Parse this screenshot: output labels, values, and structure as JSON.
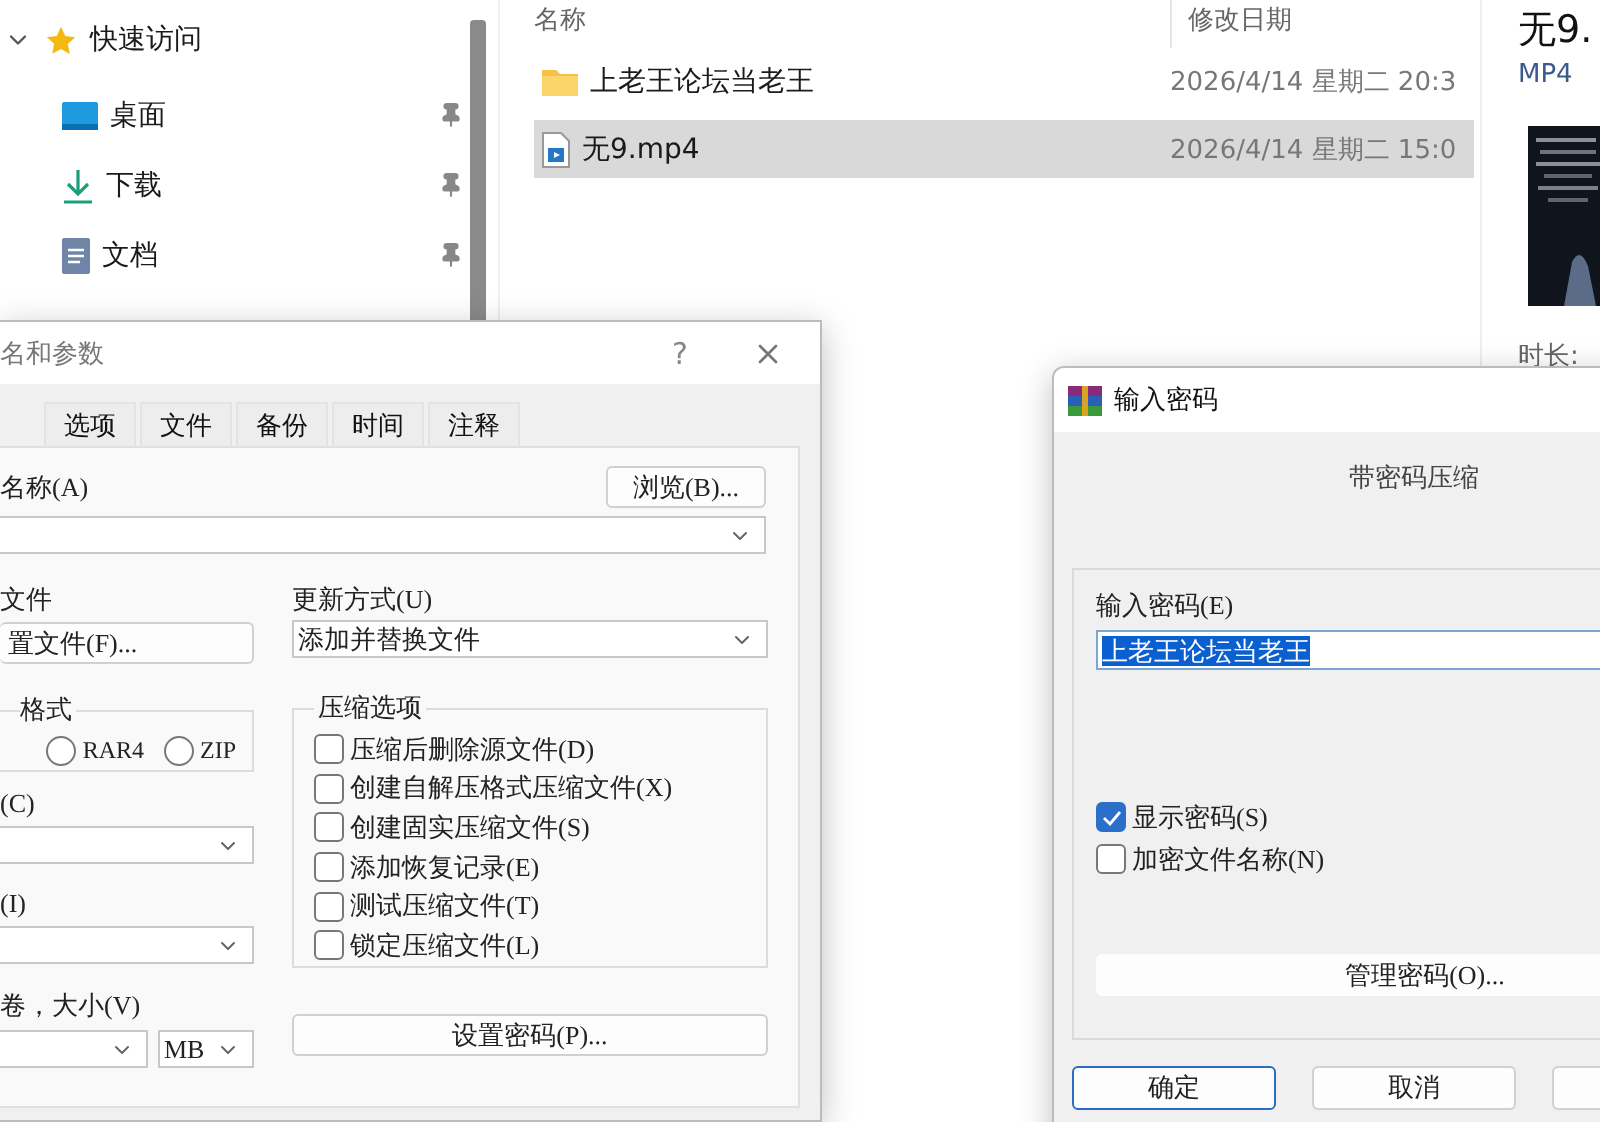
{
  "explorer": {
    "nav": {
      "header": {
        "label": "快速访问",
        "expanded": true
      },
      "items": [
        {
          "label": "桌面",
          "kind": "desktop",
          "pinned": true
        },
        {
          "label": "下载",
          "kind": "download",
          "pinned": true
        },
        {
          "label": "文档",
          "kind": "document",
          "pinned": true
        }
      ]
    },
    "columns": [
      "名称",
      "修改日期"
    ],
    "rows": [
      {
        "kind": "folder",
        "name": "上老王论坛当老王",
        "date": "2026/4/14 星期二 20:3",
        "selected": false
      },
      {
        "kind": "video",
        "name": "无9.mp4",
        "date": "2026/4/14 星期二 15:0",
        "selected": true
      }
    ],
    "preview": {
      "title": "无9.",
      "type": "MP4",
      "duration_label": "时长:"
    }
  },
  "archive_dialog": {
    "title": "名和参数",
    "help": "?",
    "tabs": [
      {
        "label": "选项",
        "selected": false
      },
      {
        "label": "文件",
        "selected": false
      },
      {
        "label": "备份",
        "selected": false
      },
      {
        "label": "时间",
        "selected": false
      },
      {
        "label": "注释",
        "selected": false
      }
    ],
    "name_label": "名称(A)",
    "browse_button": "浏览(B)...",
    "profiles_label": "文件",
    "profiles_button": "置文件(F)...",
    "update_label": "更新方式(U)",
    "update_value": "添加并替换文件",
    "format_label": "格式",
    "formats": [
      {
        "label": "RAR4",
        "selected": false
      },
      {
        "label": "ZIP",
        "selected": false
      }
    ],
    "method_label": "(C)",
    "dictionary_label": "(I)",
    "volume_label": "卷，大小(V)",
    "volume_unit": "MB",
    "options_label": "压缩选项",
    "options": [
      {
        "label": "压缩后删除源文件(D)",
        "checked": false
      },
      {
        "label": "创建自解压格式压缩文件(X)",
        "checked": false
      },
      {
        "label": "创建固实压缩文件(S)",
        "checked": false
      },
      {
        "label": "添加恢复记录(E)",
        "checked": false
      },
      {
        "label": "测试压缩文件(T)",
        "checked": false
      },
      {
        "label": "锁定压缩文件(L)",
        "checked": false
      }
    ],
    "password_button": "设置密码(P)..."
  },
  "password_dialog": {
    "title": "输入密码",
    "heading": "带密码压缩",
    "password_label": "输入密码(E)",
    "password_value": "上老王论坛当老王",
    "value_selected": true,
    "checks": [
      {
        "label": "显示密码(S)",
        "checked": true
      },
      {
        "label": "加密文件名称(N)",
        "checked": false
      }
    ],
    "manage_button": "管理密码(O)...",
    "buttons": [
      {
        "label": "确定",
        "default": true
      },
      {
        "label": "取消",
        "default": false
      },
      {
        "default": false
      }
    ]
  }
}
